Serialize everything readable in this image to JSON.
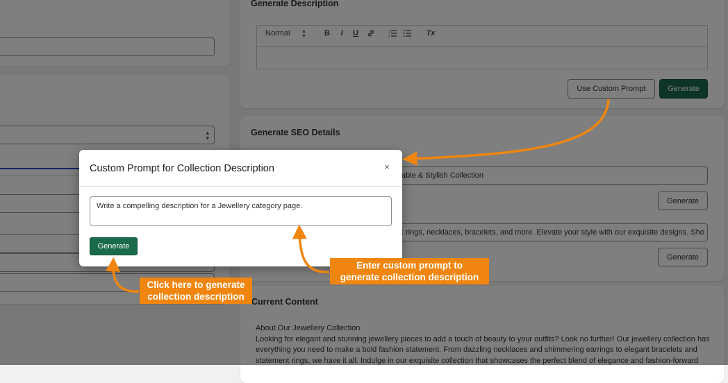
{
  "generate_description": {
    "title": "Generate Description",
    "toolbar": {
      "format_select": "Normal",
      "bold": "B",
      "italic": "I",
      "underline": "U",
      "clear_format": "Tx"
    },
    "use_custom_prompt_label": "Use Custom Prompt",
    "generate_label": "Generate"
  },
  "seo": {
    "title": "Generate SEO Details",
    "meta_title_value": "able & Stylish Collection",
    "generate_label": "Generate",
    "meta_description_value": ": rings, necklaces, bracelets, and more. Elevate your style with our exquisite designs. Sho",
    "generate_label_2": "Generate"
  },
  "current_content": {
    "title": "Current Content",
    "heading": "About Our Jewellery Collection",
    "body": "Looking for elegant and stunning jewellery pieces to add a touch of beauty to your outfits? Look no further! Our jewellery collection has everything you need to make a bold fashion statement. From dazzling necklaces and shimmering earrings to elegant bracelets and statement rings, we have it all. Indulge in our exquisite collection that showcases the perfect blend of elegance and fashion-forward"
  },
  "modal": {
    "title": "Custom Prompt for Collection Description",
    "close": "×",
    "prompt_value": "Write a compelling description for a Jewellery category page.",
    "generate_label": "Generate"
  },
  "annotations": {
    "prompt_callout_line1": "Enter custom prompt to",
    "prompt_callout_line2": "generate collection description",
    "generate_callout_line1": "Click here to generate",
    "generate_callout_line2": "collection description"
  },
  "colors": {
    "primary": "#1a6b4b",
    "callout": "#f0860f",
    "page_bg": "#f1f1f1",
    "accent_line": "#2b49c8"
  }
}
